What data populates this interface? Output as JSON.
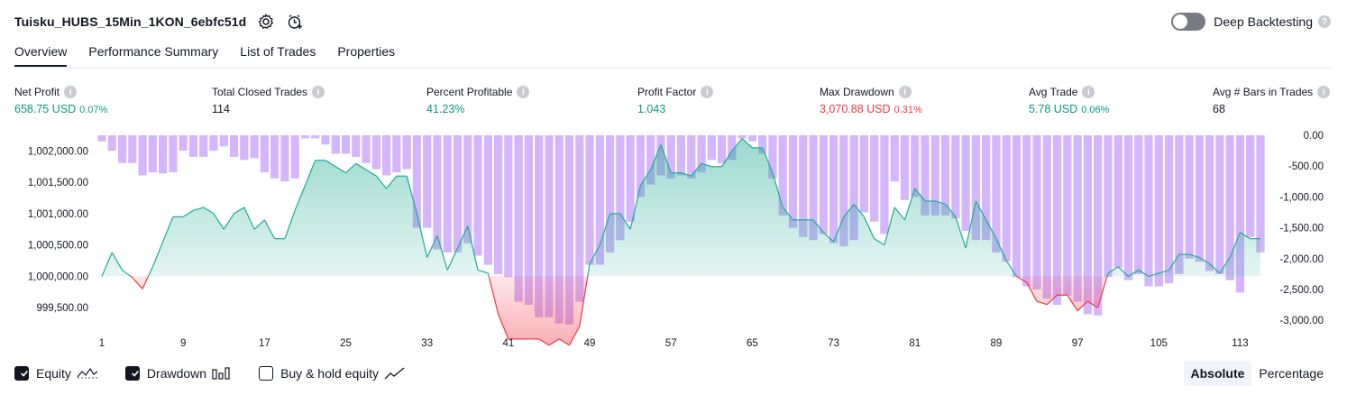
{
  "header": {
    "title": "Tuisku_HUBS_15Min_1KON_6ebfc51d",
    "deep_backtesting_label": "Deep Backtesting",
    "deep_backtesting_on": false
  },
  "tabs": [
    "Overview",
    "Performance Summary",
    "List of Trades",
    "Properties"
  ],
  "active_tab": "Overview",
  "metrics": [
    {
      "label": "Net Profit",
      "value": "658.75 USD",
      "pct": "0.07%",
      "color": "#089981"
    },
    {
      "label": "Total Closed Trades",
      "value": "114",
      "pct": "",
      "color": "#131722"
    },
    {
      "label": "Percent Profitable",
      "value": "41.23%",
      "pct": "",
      "color": "#089981"
    },
    {
      "label": "Profit Factor",
      "value": "1.043",
      "pct": "",
      "color": "#089981"
    },
    {
      "label": "Max Drawdown",
      "value": "3,070.88 USD",
      "pct": "0.31%",
      "color": "#f23645"
    },
    {
      "label": "Avg Trade",
      "value": "5.78 USD",
      "pct": "0.06%",
      "color": "#089981"
    },
    {
      "label": "Avg # Bars in Trades",
      "value": "68",
      "pct": "",
      "color": "#131722"
    }
  ],
  "legend": {
    "equity": "Equity",
    "drawdown": "Drawdown",
    "buy_hold": "Buy & hold equity",
    "equity_checked": true,
    "drawdown_checked": true,
    "buy_hold_checked": false
  },
  "view_toggle": {
    "absolute": "Absolute",
    "percentage": "Percentage",
    "selected": "Absolute"
  },
  "colors": {
    "equity_line": "#22ab94",
    "equity_fill": "#d1f0e8",
    "loss_line": "#f23645",
    "loss_fill": "#fcbcbc",
    "drawdown_bar": "#cda9fc"
  },
  "chart_data": {
    "type": "area",
    "x_ticks": [
      "1",
      "9",
      "17",
      "25",
      "33",
      "41",
      "49",
      "57",
      "65",
      "73",
      "81",
      "89",
      "97",
      "105",
      "113"
    ],
    "left_axis": {
      "ticks": [
        "1,002,000.00",
        "1,001,500.00",
        "1,001,000.00",
        "1,000,500.00",
        "1,000,000.00",
        "999,500.00"
      ],
      "range": [
        999200,
        1002250
      ],
      "baseline": 1000000
    },
    "right_axis": {
      "ticks": [
        "0.00",
        "-500.00",
        "-1,000.00",
        "-1,500.00",
        "-2,000.00",
        "-2,500.00",
        "-3,000.00"
      ],
      "range": [
        -3100,
        0
      ]
    },
    "series": [
      {
        "name": "Equity",
        "x": [
          1,
          2,
          3,
          4,
          5,
          6,
          7,
          8,
          9,
          10,
          11,
          12,
          13,
          14,
          15,
          16,
          17,
          18,
          19,
          20,
          21,
          22,
          23,
          24,
          25,
          26,
          27,
          28,
          29,
          30,
          31,
          32,
          33,
          34,
          35,
          36,
          37,
          38,
          39,
          40,
          41,
          42,
          43,
          44,
          45,
          46,
          47,
          48,
          49,
          50,
          51,
          52,
          53,
          54,
          55,
          56,
          57,
          58,
          59,
          60,
          61,
          62,
          63,
          64,
          65,
          66,
          67,
          68,
          69,
          70,
          71,
          72,
          73,
          74,
          75,
          76,
          77,
          78,
          79,
          80,
          81,
          82,
          83,
          84,
          85,
          86,
          87,
          88,
          89,
          90,
          91,
          92,
          93,
          94,
          95,
          96,
          97,
          98,
          99,
          100,
          101,
          102,
          103,
          104,
          105,
          106,
          107,
          108,
          109,
          110,
          111,
          112,
          113,
          114,
          115
        ],
        "values": [
          1000000,
          1000380,
          1000100,
          999980,
          999800,
          1000150,
          1000550,
          1000950,
          1000950,
          1001050,
          1001100,
          1001000,
          1000750,
          1001000,
          1001100,
          1000750,
          1000900,
          1000600,
          1000600,
          1001050,
          1001450,
          1001850,
          1001850,
          1001750,
          1001650,
          1001800,
          1001700,
          1001600,
          1001400,
          1001600,
          1001600,
          1001000,
          1000300,
          1000650,
          1000100,
          1000450,
          1000800,
          1000100,
          1000050,
          999400,
          999000,
          999000,
          999000,
          999000,
          998900,
          999000,
          998900,
          999200,
          1000200,
          1000500,
          1001000,
          1001000,
          1000750,
          1001450,
          1001700,
          1002100,
          1001650,
          1001650,
          1001600,
          1001800,
          1001750,
          1001750,
          1002000,
          1002200,
          1002050,
          1002050,
          1001650,
          1001100,
          1000900,
          1000900,
          1000900,
          1000700,
          1000550,
          1000950,
          1001150,
          1000950,
          1000600,
          1000500,
          1001100,
          1000900,
          1001400,
          1001200,
          1001200,
          1001150,
          1000950,
          1000450,
          1001200,
          1000900,
          1000600,
          1000250,
          1000000,
          999900,
          999600,
          999550,
          999700,
          999700,
          999450,
          999600,
          999500,
          1000050,
          1000150,
          1000000,
          1000100,
          1000000,
          1000050,
          1000100,
          1000350,
          1000350,
          1000300,
          1000200,
          1000050,
          1000300,
          1000700,
          1000600,
          1000600
        ]
      },
      {
        "name": "Drawdown",
        "x": [
          1,
          2,
          3,
          4,
          5,
          6,
          7,
          8,
          9,
          10,
          11,
          12,
          13,
          14,
          15,
          16,
          17,
          18,
          19,
          20,
          21,
          22,
          23,
          24,
          25,
          26,
          27,
          28,
          29,
          30,
          31,
          32,
          33,
          34,
          35,
          36,
          37,
          38,
          39,
          40,
          41,
          42,
          43,
          44,
          45,
          46,
          47,
          48,
          49,
          50,
          51,
          52,
          53,
          54,
          55,
          56,
          57,
          58,
          59,
          60,
          61,
          62,
          63,
          64,
          65,
          66,
          67,
          68,
          69,
          70,
          71,
          72,
          73,
          74,
          75,
          76,
          77,
          78,
          79,
          80,
          81,
          82,
          83,
          84,
          85,
          86,
          87,
          88,
          89,
          90,
          91,
          92,
          93,
          94,
          95,
          96,
          97,
          98,
          99,
          100,
          101,
          102,
          103,
          104,
          105,
          106,
          107,
          108,
          109,
          110,
          111,
          112,
          113,
          114,
          115
        ],
        "values": [
          -100,
          -250,
          -450,
          -450,
          -650,
          -600,
          -620,
          -600,
          -250,
          -350,
          -350,
          -250,
          -180,
          -350,
          -400,
          -370,
          -600,
          -700,
          -750,
          -700,
          -50,
          -50,
          -150,
          -300,
          -300,
          -350,
          -450,
          -550,
          -650,
          -600,
          -550,
          -1500,
          -1500,
          -1850,
          -1900,
          -1900,
          -1750,
          -1950,
          -2100,
          -2250,
          -2300,
          -2700,
          -2750,
          -2950,
          -2950,
          -3050,
          -3070,
          -2700,
          -2100,
          -2100,
          -1900,
          -1700,
          -1400,
          -1000,
          -800,
          -650,
          -700,
          -650,
          -700,
          -600,
          -400,
          -450,
          -400,
          -50,
          -100,
          -300,
          -700,
          -1300,
          -1500,
          -1650,
          -1700,
          -1600,
          -1750,
          -1800,
          -1700,
          -1250,
          -1400,
          -1600,
          -750,
          -1050,
          -1000,
          -1300,
          -1300,
          -1300,
          -1350,
          -1550,
          -1700,
          -1700,
          -1900,
          -2050,
          -2300,
          -2450,
          -2500,
          -2650,
          -2750,
          -2600,
          -2700,
          -2900,
          -2920,
          -2300,
          -2150,
          -2350,
          -2250,
          -2450,
          -2450,
          -2400,
          -2250,
          -2000,
          -2050,
          -2200,
          -2250,
          -2350,
          -2550,
          -1650,
          -1900
        ]
      }
    ],
    "xlim": [
      1,
      115
    ]
  }
}
